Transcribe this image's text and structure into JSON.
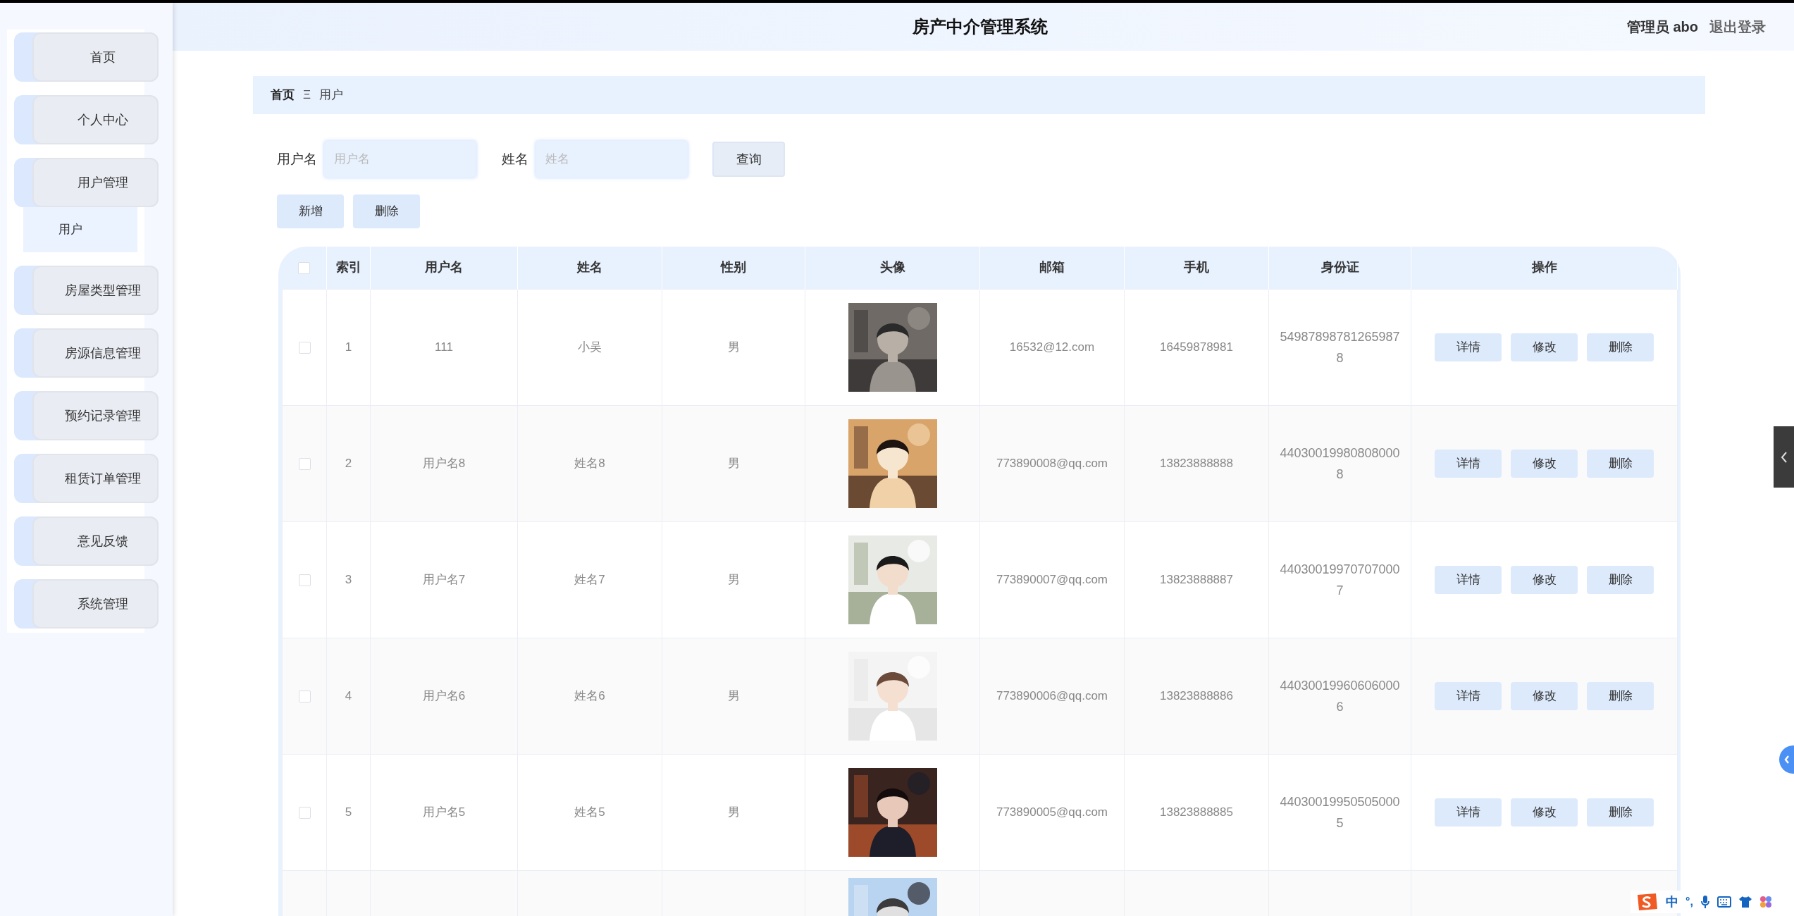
{
  "header": {
    "title": "房产中介管理系统",
    "user": "管理员 abo",
    "logout": "退出登录"
  },
  "sidebar": {
    "items": [
      {
        "label": "首页"
      },
      {
        "label": "个人中心"
      },
      {
        "label": "用户管理",
        "children": [
          {
            "label": "用户",
            "selected": true
          }
        ]
      },
      {
        "label": "房屋类型管理"
      },
      {
        "label": "房源信息管理"
      },
      {
        "label": "预约记录管理"
      },
      {
        "label": "租赁订单管理"
      },
      {
        "label": "意见反馈"
      },
      {
        "label": "系统管理"
      }
    ]
  },
  "breadcrumb": {
    "home": "首页",
    "separator": "Ξ",
    "current": "用户"
  },
  "search": {
    "fields": [
      {
        "label": "用户名",
        "placeholder": "用户名"
      },
      {
        "label": "姓名",
        "placeholder": "姓名"
      }
    ],
    "button": "查询"
  },
  "actions": [
    "新增",
    "删除"
  ],
  "table": {
    "all_checked": false,
    "columns": [
      "索引",
      "用户名",
      "姓名",
      "性别",
      "头像",
      "邮箱",
      "手机",
      "身份证",
      "操作"
    ],
    "rows": [
      {
        "checked": false,
        "index": "1",
        "username": "111",
        "name": "小吴",
        "gender": "男",
        "email": "16532@12.com",
        "phone": "16459878981",
        "id_card": "549878987812659878",
        "actions": [
          "详情",
          "修改",
          "删除"
        ]
      },
      {
        "checked": false,
        "index": "2",
        "username": "用户名8",
        "name": "姓名8",
        "gender": "男",
        "email": "773890008@qq.com",
        "phone": "13823888888",
        "id_card": "440300199808080008",
        "actions": [
          "详情",
          "修改",
          "删除"
        ]
      },
      {
        "checked": false,
        "index": "3",
        "username": "用户名7",
        "name": "姓名7",
        "gender": "男",
        "email": "773890007@qq.com",
        "phone": "13823888887",
        "id_card": "440300199707070007",
        "actions": [
          "详情",
          "修改",
          "删除"
        ]
      },
      {
        "checked": false,
        "index": "4",
        "username": "用户名6",
        "name": "姓名6",
        "gender": "男",
        "email": "773890006@qq.com",
        "phone": "13823888886",
        "id_card": "440300199606060006",
        "actions": [
          "详情",
          "修改",
          "删除"
        ]
      },
      {
        "checked": false,
        "index": "5",
        "username": "用户名5",
        "name": "姓名5",
        "gender": "男",
        "email": "773890005@qq.com",
        "phone": "13823888885",
        "id_card": "440300199505050005",
        "actions": [
          "详情",
          "修改",
          "删除"
        ]
      }
    ]
  },
  "ime": {
    "mode": "中",
    "punct": "°,"
  }
}
